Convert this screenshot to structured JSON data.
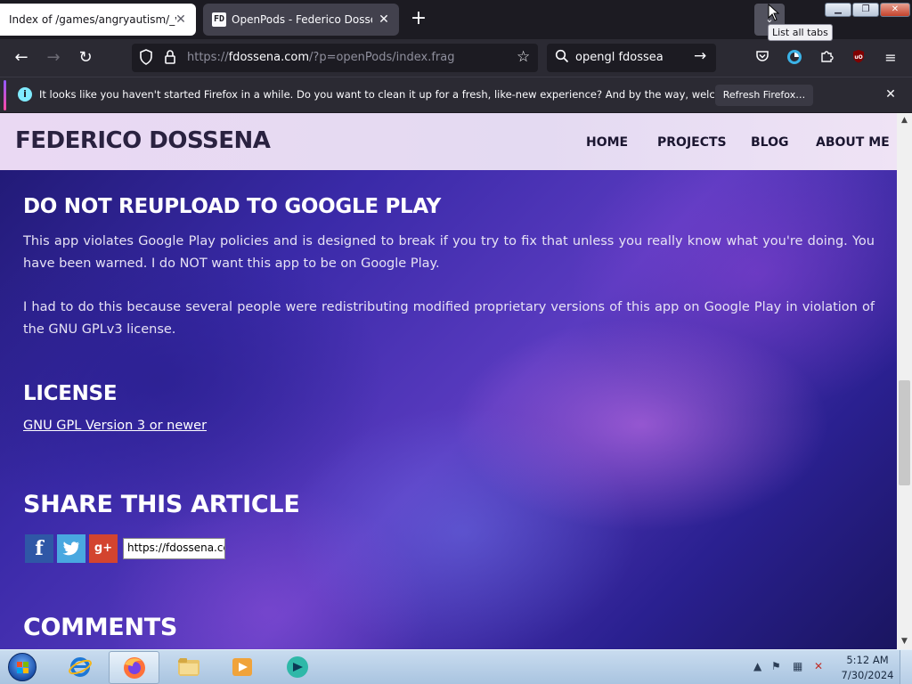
{
  "browser": {
    "tabs": [
      {
        "title": "Index of /games/angryautism/_vanilla"
      },
      {
        "title": "OpenPods - Federico Dossena",
        "favicon": "FD"
      }
    ],
    "tooltip": "List all tabs",
    "url": {
      "prefix": "https://",
      "host": "fdossena.com",
      "path": "/?p=openPods/index.frag"
    },
    "search_value": "opengl fdossea",
    "notification": {
      "text": "It looks like you haven't started Firefox in a while. Do you want to clean it up for a fresh, like-new experience? And by the way, welcome back!",
      "button": "Refresh Firefox…"
    }
  },
  "site": {
    "title": "FEDERICO DOSSENA",
    "nav": {
      "home": "HOME",
      "projects": "PROJECTS",
      "blog": "BLOG",
      "about": "ABOUT ME"
    },
    "sections": {
      "no_reupload_heading": "DO NOT REUPLOAD TO GOOGLE PLAY",
      "no_reupload_p1": "This app violates Google Play policies and is designed to break if you try to fix that unless you really know what you're doing. You have been warned. I do NOT want this app to be on Google Play.",
      "no_reupload_p2": "I had to do this because several people were redistributing modified proprietary versions of this app on Google Play in violation of the GNU GPLv3 license.",
      "license_heading": "LICENSE",
      "license_link": "GNU GPL Version 3 or newer",
      "share_heading": "SHARE THIS ARTICLE",
      "share_url": "https://fdossena.com/?p=openPods/index.frag",
      "comments_heading": "COMMENTS"
    },
    "share_icons": {
      "facebook": "f",
      "twitter": "t",
      "googleplus": "g+"
    }
  },
  "taskbar": {
    "time": "5:12 AM",
    "date": "7/30/2024"
  },
  "colors": {
    "browser_dark": "#1c1b22",
    "toolbar": "#2b2a33",
    "header_bg": "#e8dcf3",
    "facebook": "#2f57a6",
    "twitter": "#49a8e0",
    "googleplus": "#d3442f"
  }
}
